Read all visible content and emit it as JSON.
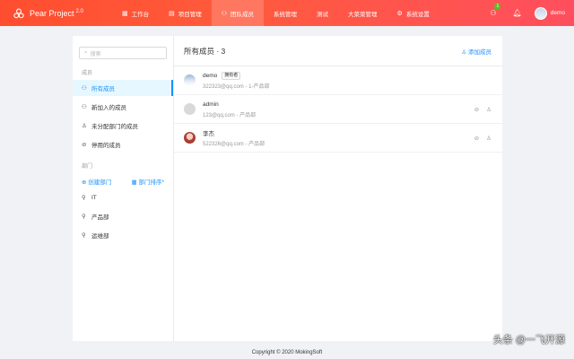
{
  "header": {
    "logo_text": "Pear Project",
    "logo_version": "2.0",
    "nav": [
      {
        "icon": "▦",
        "label": "工作台"
      },
      {
        "icon": "▤",
        "label": "项目管理"
      },
      {
        "icon": "⚇",
        "label": "团队成员"
      },
      {
        "icon": "",
        "label": "系统管理"
      },
      {
        "icon": "",
        "label": "测试"
      },
      {
        "icon": "",
        "label": "大菜菜管理"
      },
      {
        "icon": "⚙",
        "label": "系统设置"
      }
    ],
    "active_nav": 2,
    "notification_count": "1",
    "user_name": "demo"
  },
  "sidebar": {
    "search_placeholder": "搜索",
    "members_label": "成员",
    "member_items": [
      {
        "icon": "⚇",
        "label": "所有成员"
      },
      {
        "icon": "⚇",
        "label": "新加入的成员"
      },
      {
        "icon": "♙",
        "label": "未分配部门的成员"
      },
      {
        "icon": "⊘",
        "label": "停用的成员"
      }
    ],
    "dept_label": "部门",
    "create_dept": "创建部门",
    "dept_sort": "部门排序*",
    "departments": [
      {
        "icon": "⚲",
        "label": "IT"
      },
      {
        "icon": "⚲",
        "label": "产品部"
      },
      {
        "icon": "⚲",
        "label": "运维部"
      }
    ]
  },
  "main": {
    "title": "所有成员 · 3",
    "add_member": "添加成员",
    "members": [
      {
        "name": "demo",
        "tag": "拥有者",
        "meta": "322323@qq.com - 1-产品部",
        "avatar": "demo"
      },
      {
        "name": "admin",
        "tag": "",
        "meta": "123@qq.com - 产品部",
        "avatar": "admin"
      },
      {
        "name": "李杰",
        "tag": "",
        "meta": "522326@qq.com - 产品部",
        "avatar": "lijie"
      }
    ]
  },
  "footer": "Copyright © 2020 MokingSoft",
  "watermark": "头条 @一飞开源"
}
